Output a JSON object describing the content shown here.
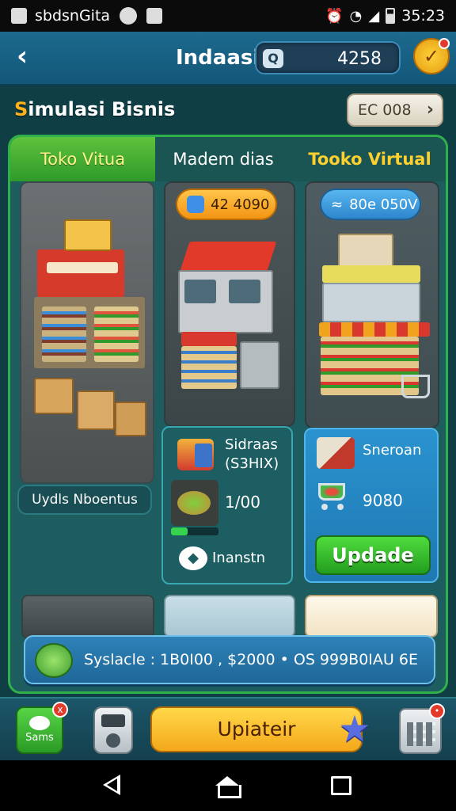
{
  "statusbar": {
    "app_name": "sbdsnGita",
    "time": "35:23"
  },
  "header": {
    "title": "Indaasi",
    "search_value": "4258"
  },
  "section": {
    "title_first": "S",
    "title_rest": "imulasi Bisnis",
    "top_pill": "EC 008"
  },
  "tabs": [
    {
      "label": "Toko Vitua"
    },
    {
      "label": "Madem dias"
    },
    {
      "label": "Tooko Virtual"
    }
  ],
  "store_pills": {
    "middle": "42 4090",
    "right": "80e 050V"
  },
  "left_label": "Uydls Nboentus",
  "mid_panel": {
    "name_line1": "Sidraas",
    "name_line2": "(S3HIX)",
    "value": "1/00",
    "progress_value": 0.35,
    "footer_label": "Inanstn"
  },
  "right_panel": {
    "name": "Sneroan",
    "value": "9080",
    "button_label": "Updade"
  },
  "summary": {
    "text": "Syslacle : 1B0I00   ,   $2000   •   OS 999B0IAU 6E"
  },
  "bottom": {
    "store_label": "Sams",
    "store_badge": "x",
    "main_button": "Upiateir",
    "calc_badge": "•"
  },
  "colors": {
    "accent_green": "#2fb04a",
    "accent_orange": "#f4a81a",
    "panel_bg": "#1e5d5f",
    "header_bg": "#1c6a8e"
  },
  "icons": {
    "back": "chevron-left-icon",
    "search": "search-icon",
    "badge": "check-badge-icon",
    "star": "star-icon"
  }
}
